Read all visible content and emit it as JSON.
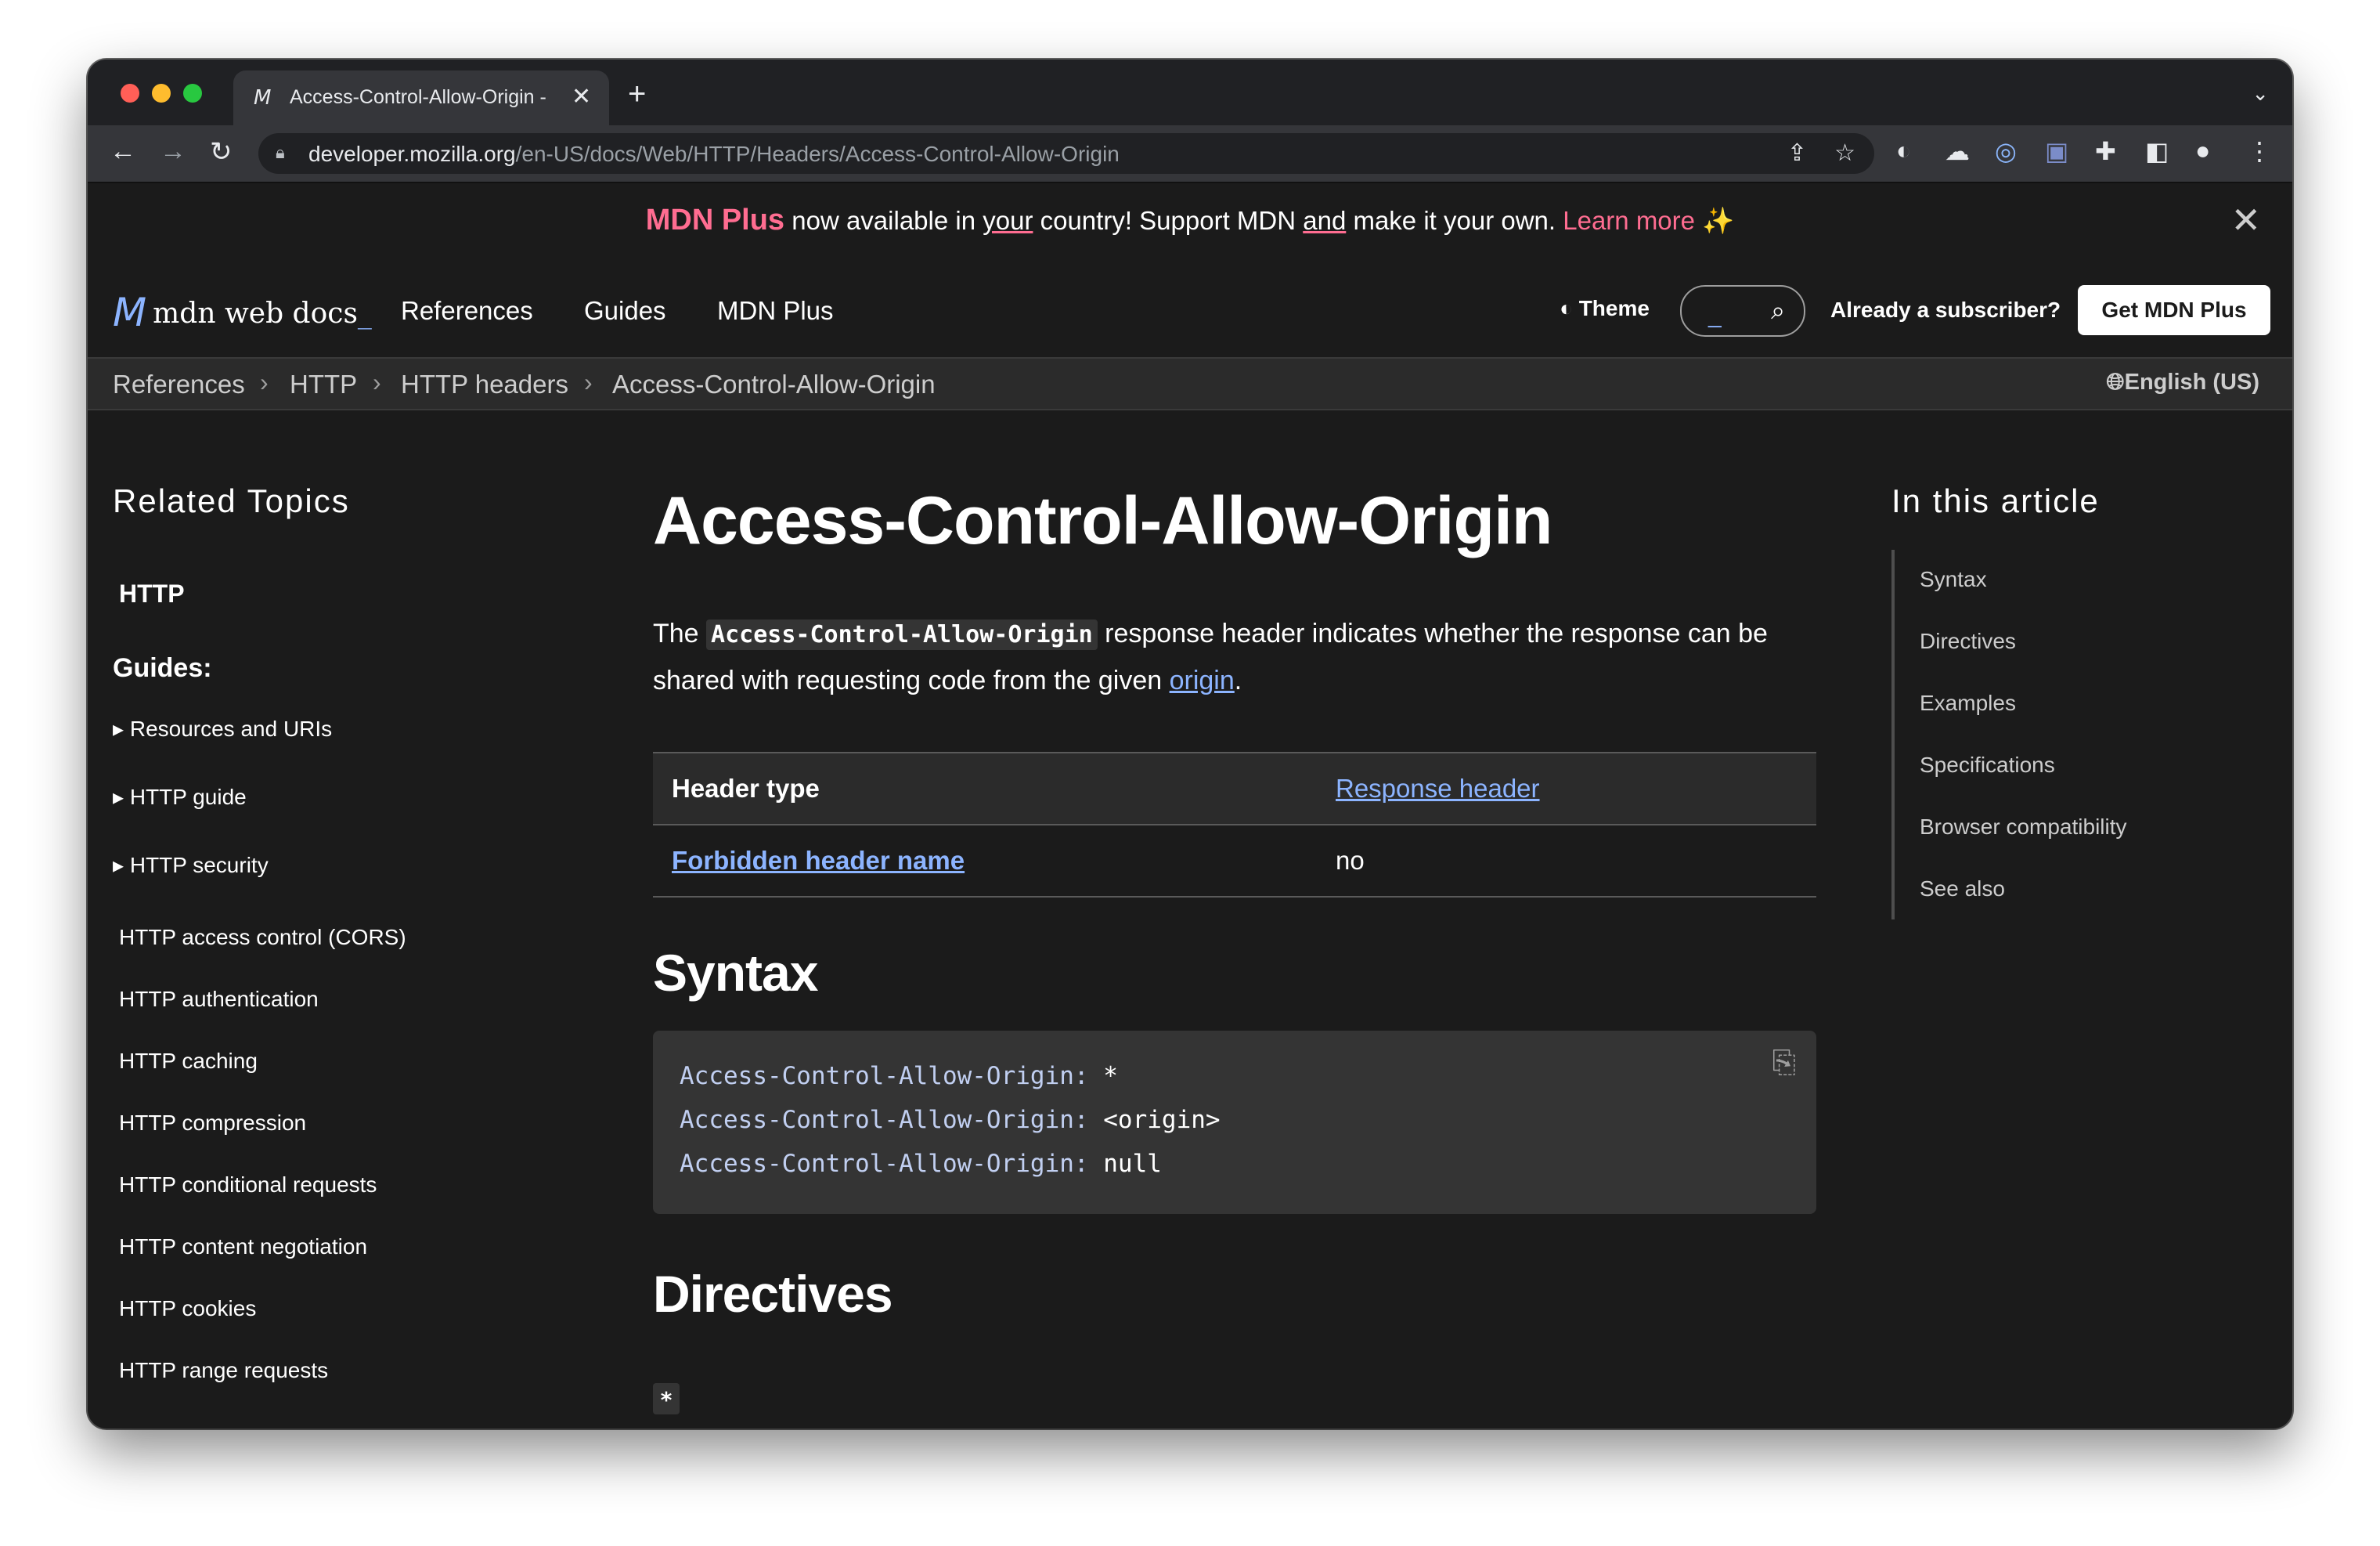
{
  "browser": {
    "tab_title": "Access-Control-Allow-Origin -",
    "tab_favicon": "M",
    "tab_close": "✕",
    "new_tab": "+",
    "tab_menu": "⌄",
    "url_host": "developer.mozilla.org",
    "url_path": "/en-US/docs/Web/HTTP/Headers/Access-Control-Allow-Origin",
    "icons": [
      "back-icon",
      "forward-icon",
      "reload-icon",
      "lock-icon",
      "share-icon",
      "bookmark-star-icon",
      "extension-icons",
      "puzzle-icon",
      "sidebar-icon",
      "profile-icon",
      "kebab-menu-icon"
    ]
  },
  "banner": {
    "plus": "MDN Plus",
    "t1": " now available in ",
    "your": "your",
    "t2": " country! Support MDN ",
    "and": "and",
    "t3": " make it your own. ",
    "learn": "Learn more ✨",
    "close": "✕",
    "accent": "#ff6d91"
  },
  "header": {
    "logo_text": "mdn web docs",
    "logo_cursor": "_",
    "nav": [
      "References",
      "Guides",
      "MDN Plus"
    ],
    "theme": "Theme",
    "already": "Already a subscriber?",
    "get_plus": "Get MDN Plus"
  },
  "breadcrumb": {
    "items": [
      "References",
      "HTTP",
      "HTTP headers",
      "Access-Control-Allow-Origin"
    ],
    "language": "English (US)"
  },
  "sidebar": {
    "title": "Related Topics",
    "section": "HTTP",
    "guides": "Guides:",
    "expandable": [
      "Resources and URIs",
      "HTTP guide",
      "HTTP security"
    ],
    "links": [
      "HTTP access control (CORS)",
      "HTTP authentication",
      "HTTP caching",
      "HTTP compression",
      "HTTP conditional requests",
      "HTTP content negotiation",
      "HTTP cookies",
      "HTTP range requests"
    ]
  },
  "main": {
    "title": "Access-Control-Allow-Origin",
    "lead_1": "The ",
    "lead_code": "Access-Control-Allow-Origin",
    "lead_2": " response header indicates whether the response can be shared with requesting code from the given ",
    "lead_link": "origin",
    "lead_3": ".",
    "table": {
      "row1_label": "Header type",
      "row1_value": "Response header",
      "row2_label": "Forbidden header name",
      "row2_value": "no"
    },
    "syntax_heading": "Syntax",
    "code": [
      {
        "key": "Access-Control-Allow-Origin:",
        "val": " *"
      },
      {
        "key": "Access-Control-Allow-Origin:",
        "val": " <origin>"
      },
      {
        "key": "Access-Control-Allow-Origin:",
        "val": " null"
      }
    ],
    "directives_heading": "Directives",
    "directive_star": "*"
  },
  "toc": {
    "title": "In this article",
    "items": [
      "Syntax",
      "Directives",
      "Examples",
      "Specifications",
      "Browser compatibility",
      "See also"
    ]
  },
  "colors": {
    "background": "#1b1b1b",
    "link": "#8cb4ff",
    "accent": "#ff6d91"
  }
}
